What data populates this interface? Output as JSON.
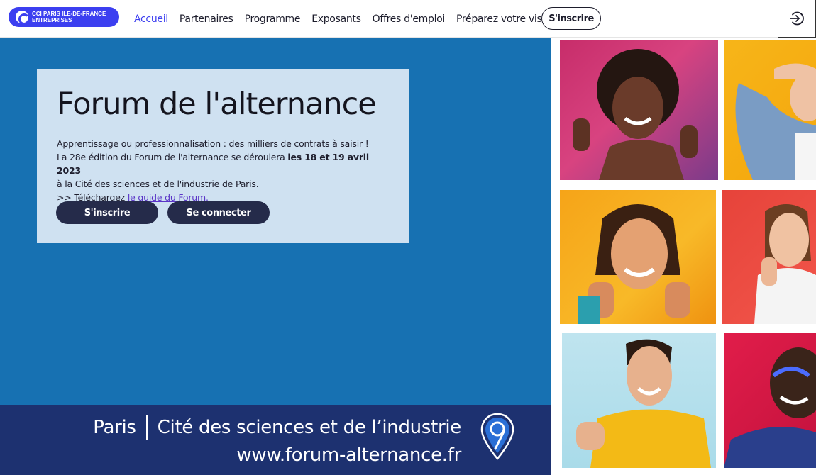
{
  "header": {
    "logo_text": "CCI PARIS ILE-DE-FRANCE\nENTREPRISES",
    "nav": [
      "Accueil",
      "Partenaires",
      "Programme",
      "Exposants",
      "Offres d'emploi",
      "Préparez votre visite"
    ],
    "signup_label": "S'inscrire"
  },
  "hero": {
    "title": "Forum de l'alternance",
    "line1": "Apprentissage ou professionnalisation : des milliers de contrats à saisir !",
    "line2_pre": "La 28e édition du Forum de l'alternance se déroulera ",
    "line2_bold": "les 18 et 19 avril 2023",
    "line3": "à la Cité des sciences et de l'industrie de Paris.",
    "line4_pre": ">> Téléchargez ",
    "line4_link": "le guide du Forum.",
    "btn_signup": "S'inscrire",
    "btn_login": "Se connecter"
  },
  "banner": {
    "city": "Paris",
    "venue": "Cité des sciences et de l’industrie",
    "url": "www.forum-alternance.fr"
  },
  "colors": {
    "accent": "#3c3ff0",
    "hero_bg": "#1771b2",
    "card_bg": "#cfe1f1",
    "banner_bg": "#1d3170",
    "button_dark": "#252b4a"
  }
}
